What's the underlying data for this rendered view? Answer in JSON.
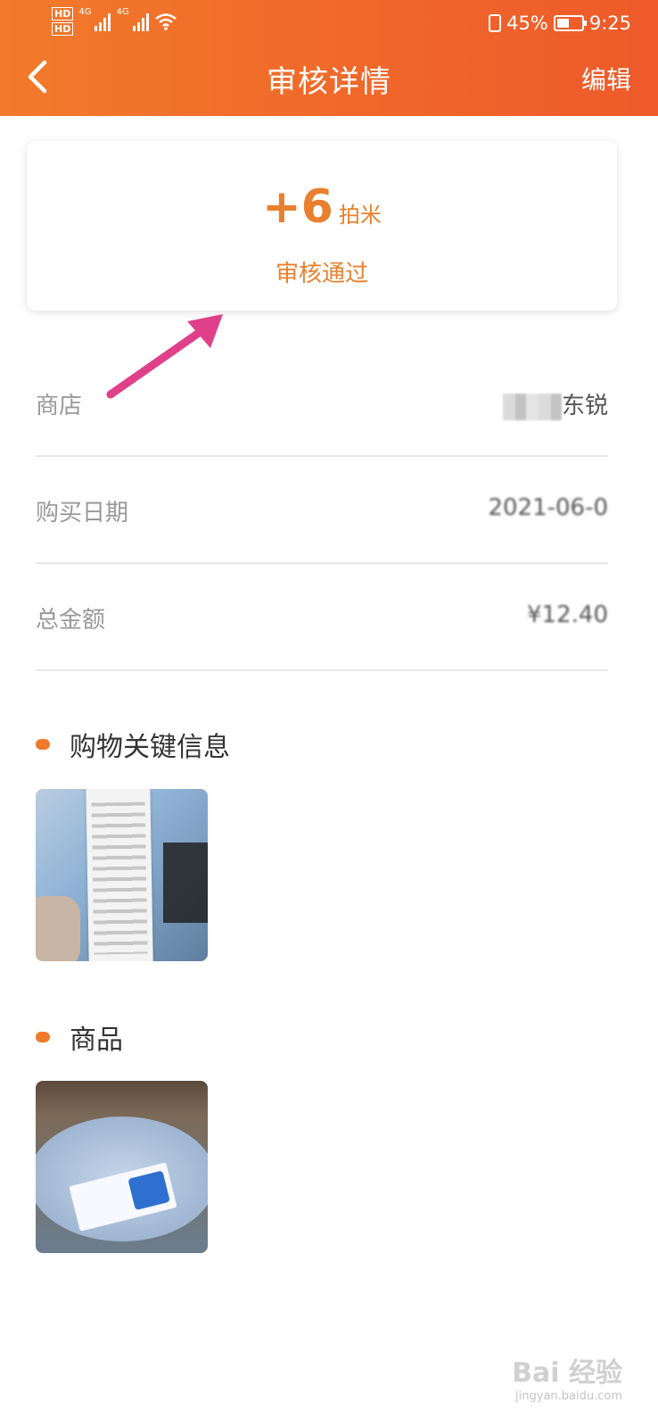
{
  "status_bar": {
    "network": [
      "HD",
      "HD",
      "4G",
      "4G"
    ],
    "battery_percent": "45%",
    "battery_level": 0.45,
    "time": "9:25",
    "icons": [
      "vibrate-icon",
      "battery-icon",
      "wifi-icon",
      "signal-icon"
    ]
  },
  "header": {
    "title": "审核详情",
    "edit_label": "编辑",
    "back_icon": "back-arrow-icon",
    "colors": {
      "gradient_start": "#f27a2b",
      "gradient_end": "#ee5a2a"
    }
  },
  "summary": {
    "points": "+6",
    "unit": "拍米",
    "status": "审核通过",
    "accent_color": "#e8802f"
  },
  "details": [
    {
      "label": "商店",
      "value": "东锐"
    },
    {
      "label": "购买日期",
      "value": "2021-06-0"
    },
    {
      "label": "总金额",
      "value": "¥12.40"
    }
  ],
  "sections": {
    "receipt": {
      "title": "购物关键信息"
    },
    "product": {
      "title": "商品"
    }
  },
  "watermark": {
    "brand": "Bai 经验",
    "url": "jingyan.baidu.com"
  }
}
